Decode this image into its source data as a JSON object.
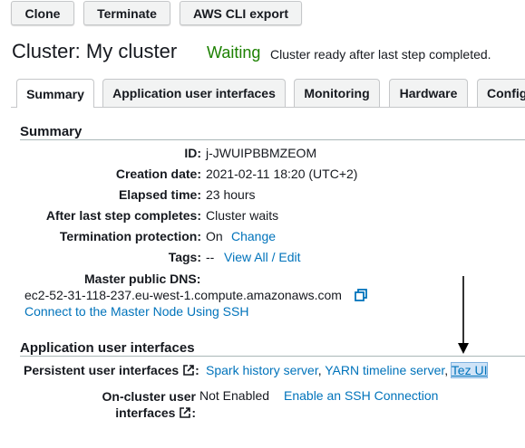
{
  "toolbar": {
    "clone_label": "Clone",
    "terminate_label": "Terminate",
    "cli_export_label": "AWS CLI export"
  },
  "cluster": {
    "title": "Cluster: My cluster",
    "status": "Waiting",
    "status_message": "Cluster ready after last step completed."
  },
  "tabs": [
    {
      "label": "Summary",
      "active": true
    },
    {
      "label": "Application user interfaces",
      "active": false
    },
    {
      "label": "Monitoring",
      "active": false
    },
    {
      "label": "Hardware",
      "active": false
    },
    {
      "label": "Config",
      "active": false
    }
  ],
  "summary": {
    "section_title": "Summary",
    "id_label": "ID:",
    "id_value": "j-JWUIPBBMZEOM",
    "creation_label": "Creation date:",
    "creation_value": "2021-02-11 18:20 (UTC+2)",
    "elapsed_label": "Elapsed time:",
    "elapsed_value": "23 hours",
    "after_step_label": "After last step completes:",
    "after_step_value": "Cluster waits",
    "termination_label": "Termination protection:",
    "termination_value": "On",
    "termination_change": "Change",
    "tags_label": "Tags:",
    "tags_value": "--",
    "tags_link": "View All / Edit",
    "dns_label": "Master public DNS:",
    "dns_value": "ec2-52-31-118-237.eu-west-1.compute.amazonaws.com",
    "ssh_link": "Connect to the Master Node Using SSH"
  },
  "app_ui": {
    "section_title": "Application user interfaces",
    "persistent_label": "Persistent user interfaces",
    "persistent_links": [
      "Spark history server",
      "YARN timeline server",
      "Tez UI"
    ],
    "oncluster_label_line1": "On-cluster user",
    "oncluster_label_line2": "interfaces",
    "oncluster_value": "Not Enabled",
    "oncluster_link": "Enable an SSH Connection"
  },
  "colors": {
    "status_green": "#1d8102",
    "link_blue": "#0073bb"
  }
}
